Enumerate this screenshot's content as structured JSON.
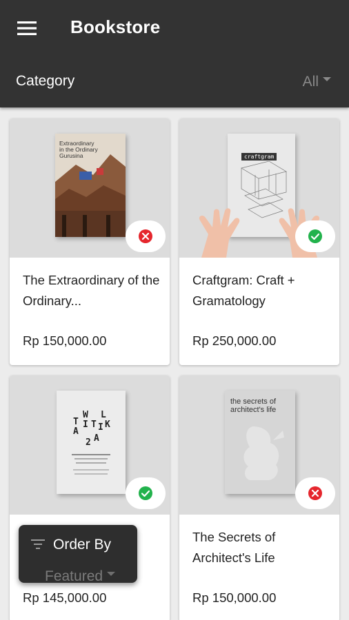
{
  "app": {
    "title": "Bookstore"
  },
  "filter": {
    "category_label": "Category",
    "category_value": "All"
  },
  "order": {
    "label": "Order By",
    "value": "Featured"
  },
  "products": [
    {
      "title": "The Extraordinary of the Ordinary...",
      "price": "Rp 150,000.00",
      "status": "unavailable",
      "cover_text": [
        "Extraordinary",
        "in the Ordinary",
        "Gurusina"
      ]
    },
    {
      "title": "Craftgram: Craft + Gramatology",
      "price": "Rp 250,000.00",
      "status": "available",
      "cover_text": [
        "craftgram"
      ]
    },
    {
      "title": "",
      "price": "Rp 145,000.00",
      "status": "available",
      "cover_text": [
        "T",
        "W",
        "L",
        "A",
        "I",
        "T",
        "I",
        "K",
        "A",
        "2"
      ]
    },
    {
      "title": "The Secrets of Architect's Life",
      "price": "Rp 150,000.00",
      "status": "unavailable",
      "cover_text": [
        "the secrets of",
        "architect's life"
      ]
    }
  ],
  "icons": {
    "menu": "hamburger-menu-icon",
    "dropdown": "caret-down-icon",
    "sort": "sort-filter-icon",
    "available": "check-circle-icon",
    "unavailable": "cross-circle-icon"
  },
  "colors": {
    "appbar": "#333333",
    "available": "#22b24c",
    "unavailable": "#e5262d",
    "background": "#ececec"
  }
}
